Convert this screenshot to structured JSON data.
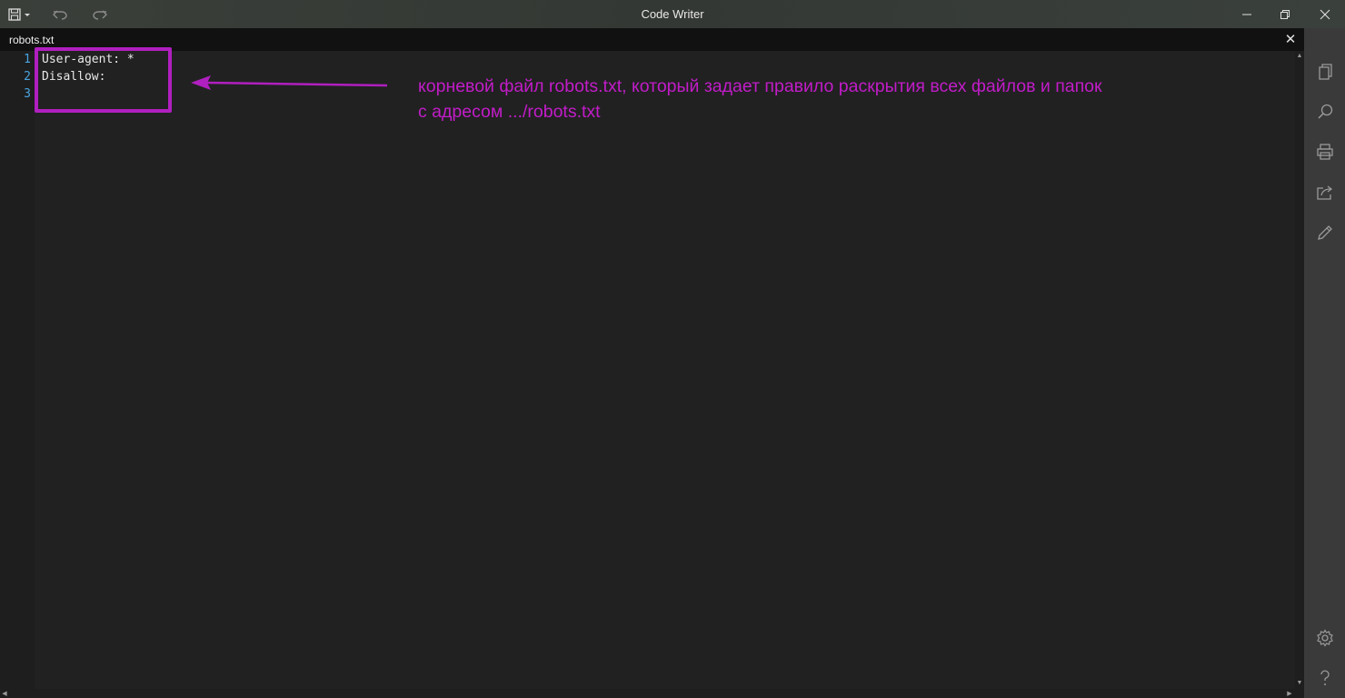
{
  "window": {
    "title": "Code Writer"
  },
  "tab": {
    "label": "robots.txt",
    "close_glyph": "✕"
  },
  "editor": {
    "line_numbers": [
      "1",
      "2",
      "3"
    ],
    "lines": [
      "User-agent: *",
      "Disallow:",
      ""
    ]
  },
  "annotation": {
    "text_line1": "корневой файл robots.txt, который задает правило раскрытия всех файлов и папок",
    "text_line2": "с адресом .../robots.txt",
    "color": "#c21cc9"
  },
  "sidebar": {
    "icons": [
      "pages-icon",
      "search-icon",
      "print-icon",
      "share-icon",
      "pen-icon",
      "settings-icon",
      "help-icon"
    ]
  },
  "colors": {
    "accent_magenta": "#b01fbf",
    "line_number": "#4aa3df"
  }
}
